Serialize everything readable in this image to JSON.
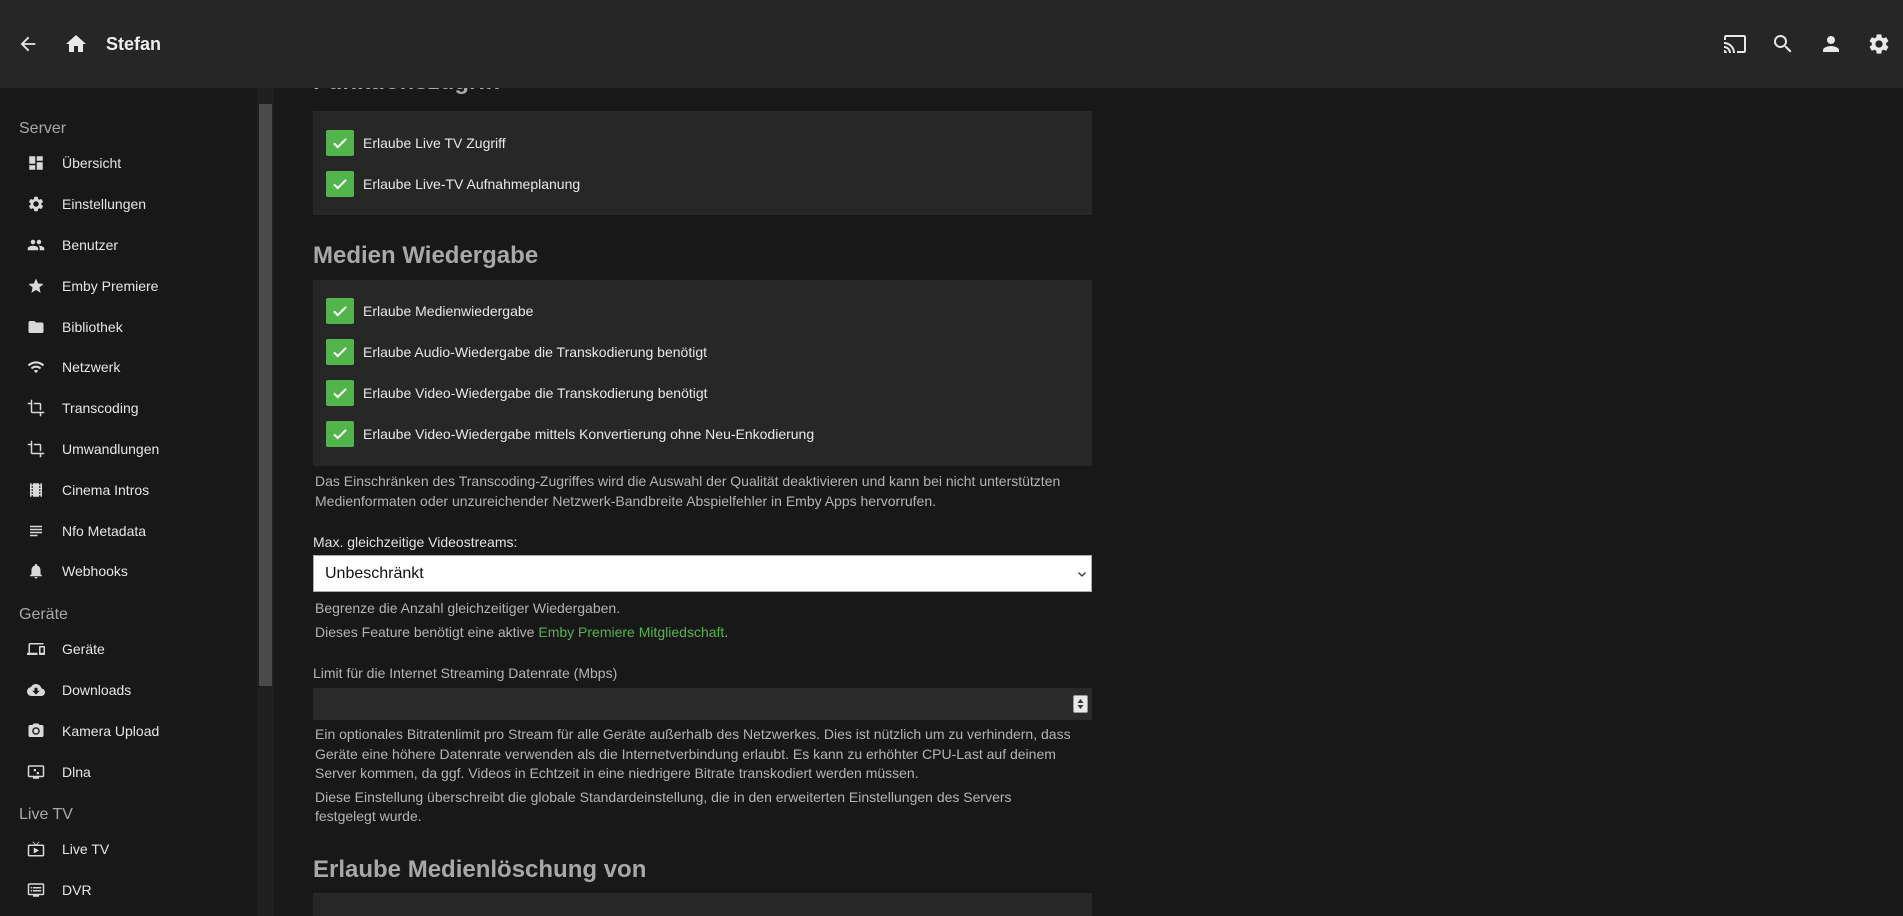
{
  "header": {
    "title": "Stefan",
    "icons": [
      "arrow-back-icon",
      "home-icon",
      "cast-icon",
      "search-icon",
      "person-icon",
      "settings-icon"
    ]
  },
  "sidebar": {
    "groups": [
      {
        "label": "Server",
        "items": [
          {
            "label": "Übersicht",
            "icon": "dashboard-icon"
          },
          {
            "label": "Einstellungen",
            "icon": "gear-icon"
          },
          {
            "label": "Benutzer",
            "icon": "people-icon"
          },
          {
            "label": "Emby Premiere",
            "icon": "star-icon"
          },
          {
            "label": "Bibliothek",
            "icon": "folder-icon"
          },
          {
            "label": "Netzwerk",
            "icon": "wifi-icon"
          },
          {
            "label": "Transcoding",
            "icon": "crop-icon"
          },
          {
            "label": "Umwandlungen",
            "icon": "crop-icon"
          },
          {
            "label": "Cinema Intros",
            "icon": "film-icon"
          },
          {
            "label": "Nfo Metadata",
            "icon": "lines-icon"
          },
          {
            "label": "Webhooks",
            "icon": "bell-icon"
          }
        ]
      },
      {
        "label": "Geräte",
        "items": [
          {
            "label": "Geräte",
            "icon": "devices-icon"
          },
          {
            "label": "Downloads",
            "icon": "cloud-download-icon"
          },
          {
            "label": "Kamera Upload",
            "icon": "camera-icon"
          },
          {
            "label": "Dlna",
            "icon": "dlna-icon"
          }
        ]
      },
      {
        "label": "Live TV",
        "items": [
          {
            "label": "Live TV",
            "icon": "live-tv-icon"
          },
          {
            "label": "DVR",
            "icon": "dvr-icon"
          }
        ]
      }
    ]
  },
  "main": {
    "feature_access": {
      "heading": "Funktionszugriff",
      "checkboxes": [
        {
          "label": "Erlaube Live TV Zugriff",
          "checked": true
        },
        {
          "label": "Erlaube Live-TV Aufnahmeplanung",
          "checked": true
        }
      ]
    },
    "media_playback": {
      "heading": "Medien Wiedergabe",
      "checkboxes": [
        {
          "label": "Erlaube Medienwiedergabe",
          "checked": true
        },
        {
          "label": "Erlaube Audio-Wiedergabe die Transkodierung benötigt",
          "checked": true
        },
        {
          "label": "Erlaube Video-Wiedergabe die Transkodierung benötigt",
          "checked": true
        },
        {
          "label": "Erlaube Video-Wiedergabe mittels Konvertierung ohne Neu-Enkodierung",
          "checked": true
        }
      ],
      "help_line1": "Das Einschränken des Transcoding-Zugriffes wird die Auswahl der Qualität deaktivieren und kann bei nicht unterstützten",
      "help_line2": "Medienformaten oder unzureichender Netzwerk-Bandbreite Abspielfehler in Emby Apps hervorrufen."
    },
    "max_streams": {
      "label": "Max. gleichzeitige Videostreams:",
      "value": "Unbeschränkt",
      "help1": "Begrenze die Anzahl gleichzeitiger Wiedergaben.",
      "help2_prefix": "Dieses Feature benötigt eine aktive ",
      "help2_link": "Emby Premiere Mitgliedschaft",
      "help2_suffix": "."
    },
    "bitrate_limit": {
      "label": "Limit für die Internet Streaming Datenrate (Mbps)",
      "value": "",
      "help_line1": "Ein optionales Bitratenlimit pro Stream für alle Geräte außerhalb des Netzwerkes. Dies ist nützlich um zu verhindern, dass",
      "help_line2": "Geräte eine höhere Datenrate verwenden als die Internetverbindung erlaubt. Es kann zu erhöhter CPU-Last auf deinem",
      "help_line3": "Server kommen, da ggf. Videos in Echtzeit in eine niedrigere Bitrate transkodiert werden müssen.",
      "help_line4": "Diese Einstellung überschreibt die globale Standardeinstellung, die in den erweiterten Einstellungen des Servers",
      "help_line5": "festgelegt wurde."
    },
    "media_deletion": {
      "heading": "Erlaube Medienlöschung von"
    }
  },
  "colors": {
    "accent": "#52b54b",
    "topbar": "#262626",
    "background": "#181818",
    "panel": "#272727"
  }
}
